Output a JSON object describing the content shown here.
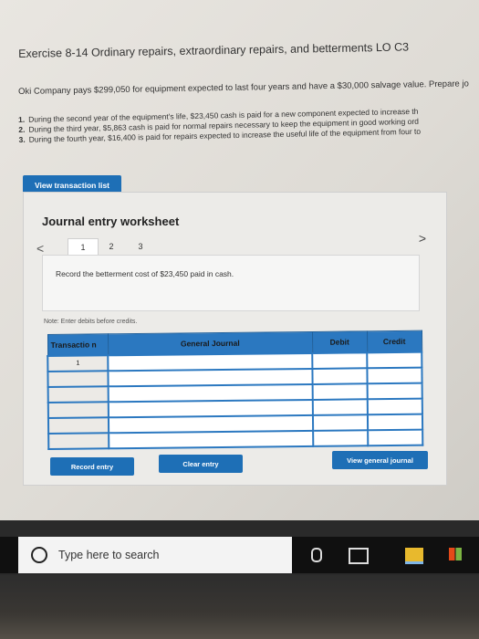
{
  "exercise_title": "Exercise 8-14 Ordinary repairs, extraordinary repairs, and betterments LO C3",
  "intro": "Oki Company pays $299,050 for equipment expected to last four years and have a $30,000 salvage value. Prepare jo",
  "steps": [
    {
      "num": "1.",
      "text": "During the second year of the equipment's life, $23,450 cash is paid for a new component expected to increase th"
    },
    {
      "num": "2.",
      "text": "During the third year, $5,863 cash is paid for normal repairs necessary to keep the equipment in good working ord"
    },
    {
      "num": "3.",
      "text": "During the fourth year, $16,400 is paid for repairs expected to increase the useful life of the equipment from four to"
    }
  ],
  "view_transaction_list": "View transaction list",
  "worksheet": {
    "title": "Journal entry worksheet",
    "prev": "<",
    "next": ">",
    "tabs": [
      "1",
      "2",
      "3"
    ],
    "active_tab": 0,
    "instruction": "Record the betterment cost of $23,450 paid in cash.",
    "note": "Note: Enter debits before credits.",
    "columns": {
      "transaction": "Transactio n",
      "general_journal": "General Journal",
      "debit": "Debit",
      "credit": "Credit"
    },
    "rows": [
      {
        "transaction": "1",
        "account": "",
        "debit": "",
        "credit": ""
      },
      {
        "transaction": "",
        "account": "",
        "debit": "",
        "credit": ""
      },
      {
        "transaction": "",
        "account": "",
        "debit": "",
        "credit": ""
      },
      {
        "transaction": "",
        "account": "",
        "debit": "",
        "credit": ""
      },
      {
        "transaction": "",
        "account": "",
        "debit": "",
        "credit": ""
      },
      {
        "transaction": "",
        "account": "",
        "debit": "",
        "credit": ""
      }
    ],
    "record_entry": "Record entry",
    "clear_entry": "Clear entry",
    "view_general_journal": "View general journal"
  },
  "taskbar": {
    "search_placeholder": "Type here to search"
  },
  "colors": {
    "accent": "#1e6fb6",
    "table_header": "#2b78c0",
    "taskbar": "#101010"
  }
}
